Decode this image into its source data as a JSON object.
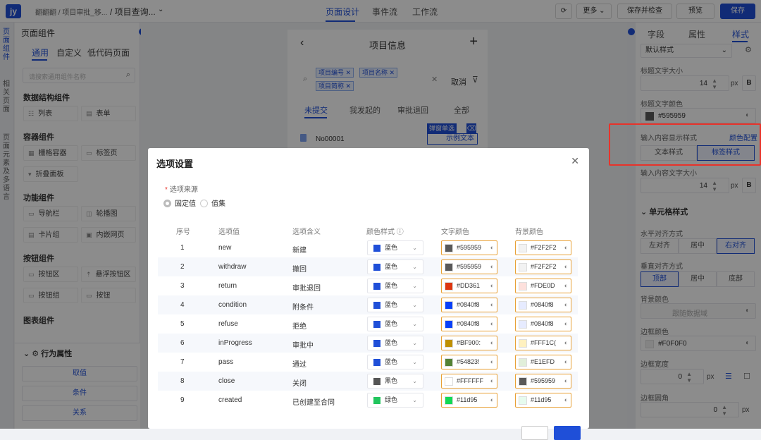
{
  "app": {
    "logo": "jy",
    "breadcrumb": "翻翻翻 / 项目审批_移...",
    "current_page": "/ 项目查询...",
    "chevron": "⌄"
  },
  "top_tabs": [
    {
      "label": "页面设计"
    },
    {
      "label": "事件流"
    },
    {
      "label": "工作流"
    }
  ],
  "toolbar": {
    "more": "更多 ⌄",
    "save_check": "保存并检查",
    "preview": "预览",
    "save": "保存"
  },
  "left_rail": [
    "页面组件",
    "相关页面",
    "页面元素及多语言"
  ],
  "left_panel": {
    "title": "页面组件",
    "tabs": [
      "通用",
      "自定义",
      "低代码页面"
    ],
    "search_placeholder": "请搜索通用组件名称",
    "sections": [
      {
        "title": "数据结构组件",
        "items": [
          "列表",
          "表单"
        ]
      },
      {
        "title": "容器组件",
        "items": [
          "栅格容器",
          "标签页",
          "折叠面板"
        ]
      },
      {
        "title": "功能组件",
        "items": [
          "导航栏",
          "轮播图",
          "卡片组",
          "内嵌网页"
        ]
      },
      {
        "title": "按钮组件",
        "items": [
          "按钮区",
          "悬浮按钮区",
          "按钮组",
          "按钮"
        ]
      },
      {
        "title": "图表组件",
        "items": []
      }
    ],
    "behavior": {
      "title": "行为属性",
      "buttons": [
        "取值",
        "条件",
        "关系"
      ]
    }
  },
  "phone": {
    "title": "项目信息",
    "chips": [
      "项目编号",
      "项目名称",
      "项目简称"
    ],
    "cancel": "取消",
    "tabs": [
      "未提交",
      "我发起的",
      "审批退回",
      "全部"
    ],
    "row": "No00001",
    "popup_tag": "弹窗单选",
    "sample_text": "示例文本"
  },
  "right_panel": {
    "tabs": [
      "字段",
      "属性",
      "样式"
    ],
    "default_style": "默认样式",
    "title_font_size_label": "标题文字大小",
    "title_font_size": "14",
    "unit": "px",
    "bold": "B",
    "title_color_label": "标题文字颜色",
    "title_color": "#595959",
    "input_style_label": "输入内容显示样式",
    "color_config": "颜色配置",
    "text_style": "文本样式",
    "tag_style": "标签样式",
    "input_font_size_label": "输入内容文字大小",
    "input_font_size": "14",
    "cell_style": "单元格样式",
    "h_align_label": "水平对齐方式",
    "h_align": [
      "左对齐",
      "居中",
      "右对齐"
    ],
    "v_align_label": "垂直对齐方式",
    "v_align": [
      "顶部",
      "居中",
      "底部"
    ],
    "bg_color_label": "背景颜色",
    "bg_color_placeholder": "跟随数据域",
    "border_color_label": "边框颜色",
    "border_color": "#F0F0F0",
    "border_width_label": "边框宽度",
    "border_width": "0",
    "border_radius_label": "边框圆角",
    "border_radius": "0"
  },
  "modal": {
    "title": "选项设置",
    "source_label": "选项来源",
    "source_options": [
      "固定值",
      "值集"
    ],
    "headers": [
      "序号",
      "选项值",
      "选项含义",
      "颜色样式 ⓘ",
      "文字颜色",
      "背景颜色"
    ],
    "rows": [
      {
        "no": "1",
        "value": "new",
        "meaning": "新建",
        "style": "蓝色",
        "style_color": "#1f4fd8",
        "text_color": "#595959",
        "text_hex": "#595959",
        "bg_color": "#F2F2F2",
        "bg_hex": "#F2F2F2"
      },
      {
        "no": "2",
        "value": "withdraw",
        "meaning": "撤回",
        "style": "蓝色",
        "style_color": "#1f4fd8",
        "text_color": "#595959",
        "text_hex": "#595959",
        "bg_color": "#F2F2F2",
        "bg_hex": "#F2F2F2"
      },
      {
        "no": "3",
        "value": "return",
        "meaning": "审批退回",
        "style": "蓝色",
        "style_color": "#1f4fd8",
        "text_color": "#DD3610",
        "text_hex": "#DD361",
        "bg_color": "#FDE0DC",
        "bg_hex": "#FDE0D"
      },
      {
        "no": "4",
        "value": "condition",
        "meaning": "附条件",
        "style": "蓝色",
        "style_color": "#1f4fd8",
        "text_color": "#0840f8",
        "text_hex": "#0840f8",
        "bg_color": "#e6ebff",
        "bg_hex": "#0840f8"
      },
      {
        "no": "5",
        "value": "refuse",
        "meaning": "拒绝",
        "style": "蓝色",
        "style_color": "#1f4fd8",
        "text_color": "#0840f8",
        "text_hex": "#0840f8",
        "bg_color": "#e6ebff",
        "bg_hex": "#0840f8"
      },
      {
        "no": "6",
        "value": "inProgress",
        "meaning": "审批中",
        "style": "蓝色",
        "style_color": "#1f4fd8",
        "text_color": "#BF9001",
        "text_hex": "#BF900:",
        "bg_color": "#FFF1C0",
        "bg_hex": "#FFF1C("
      },
      {
        "no": "7",
        "value": "pass",
        "meaning": "通过",
        "style": "蓝色",
        "style_color": "#1f4fd8",
        "text_color": "#548235",
        "text_hex": "#54823!",
        "bg_color": "#E1EFDA",
        "bg_hex": "#E1EFD"
      },
      {
        "no": "8",
        "value": "close",
        "meaning": "关闭",
        "style": "黑色",
        "style_color": "#555555",
        "text_color": "#FFFFFF",
        "text_hex": "#FFFFFF",
        "bg_color": "#595959",
        "bg_hex": "#595959"
      },
      {
        "no": "9",
        "value": "created",
        "meaning": "已创建至合同",
        "style": "绿色",
        "style_color": "#22c55e",
        "text_color": "#11d954",
        "text_hex": "#11d95",
        "bg_color": "#e6fbee",
        "bg_hex": "#11d95"
      }
    ]
  }
}
